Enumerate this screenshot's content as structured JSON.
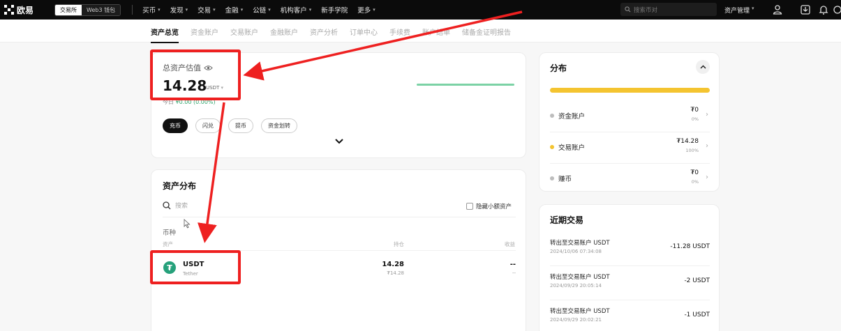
{
  "topbar": {
    "logo_text": "欧易",
    "mode_exchange": "交易所",
    "mode_web3": "Web3 钱包",
    "nav": [
      {
        "label": "买币"
      },
      {
        "label": "发现"
      },
      {
        "label": "交易"
      },
      {
        "label": "金融"
      },
      {
        "label": "公链"
      },
      {
        "label": "机构客户"
      },
      {
        "label": "新手学院"
      },
      {
        "label": "更多"
      }
    ],
    "search_placeholder": "搜索币对",
    "assets_menu": "资产管理"
  },
  "subnav": {
    "tabs": [
      "资产总览",
      "资金账户",
      "交易账户",
      "金融账户",
      "资产分析",
      "订单中心",
      "手续费",
      "账户结单",
      "储备金证明报告"
    ],
    "active": 0
  },
  "total": {
    "label": "总资产估值",
    "value": "14.28",
    "unit": "USDT",
    "pnl_label": "今日",
    "pnl_value": "¥0.00 (0.00%)",
    "pills": [
      "充币",
      "闪兑",
      "提币",
      "资金划转"
    ]
  },
  "distribution": {
    "title": "资产分布",
    "search_placeholder": "搜索",
    "hide_small": "隐藏小额资产",
    "coin_label": "币种",
    "columns": {
      "asset": "资产",
      "holding": "持仓",
      "pnl": "收益"
    },
    "rows": [
      {
        "symbol": "USDT",
        "name": "Tether",
        "holding": "14.28",
        "holding_sub": "₮14.28",
        "pnl": "--",
        "pnl_sub": "--"
      }
    ]
  },
  "fenbu": {
    "title": "分布",
    "accounts": [
      {
        "name": "资金账户",
        "value": "₮0",
        "pct": "0%",
        "color": "#bdbdbd"
      },
      {
        "name": "交易账户",
        "value": "₮14.28",
        "pct": "100%",
        "color": "#f4c430"
      },
      {
        "name": "赚币",
        "value": "₮0",
        "pct": "0%",
        "color": "#bdbdbd"
      }
    ]
  },
  "recent": {
    "title": "近期交易",
    "items": [
      {
        "name": "转出至交易账户 USDT",
        "time": "2024/10/06 07:34:08",
        "amount": "-11.28 USDT"
      },
      {
        "name": "转出至交易账户 USDT",
        "time": "2024/09/29 20:05:14",
        "amount": "-2 USDT"
      },
      {
        "name": "转出至交易账户 USDT",
        "time": "2024/09/29 20:02:21",
        "amount": "-1 USDT"
      }
    ]
  },
  "colors": {
    "accent_red": "#ee2020",
    "pnl_green": "#2ea36b",
    "bar_yellow": "#f4c430"
  }
}
